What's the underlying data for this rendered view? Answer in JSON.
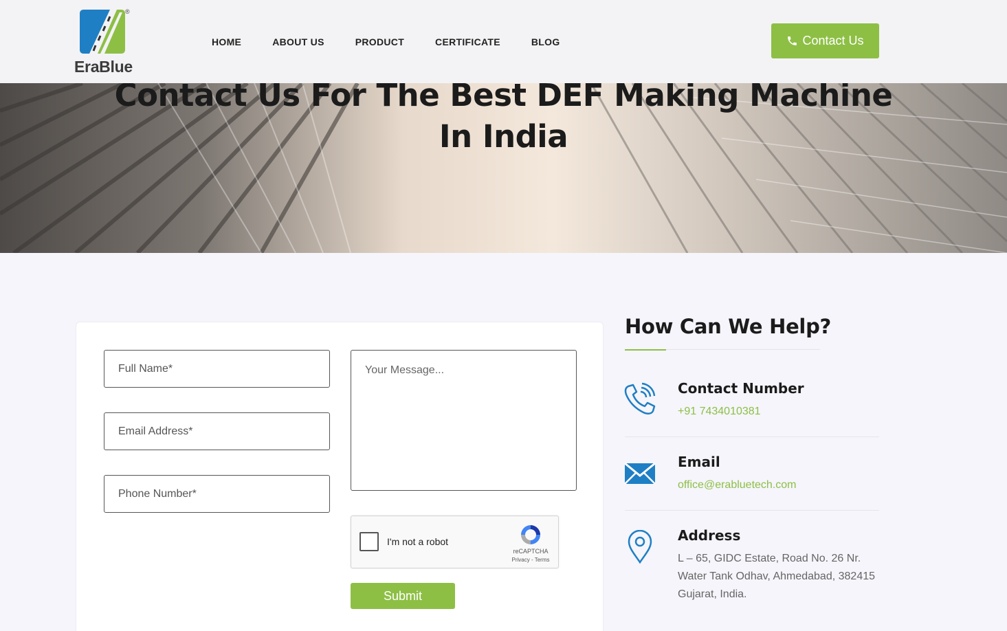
{
  "brand": {
    "name": "EraBlue",
    "registered_mark": "®"
  },
  "nav": {
    "items": [
      {
        "label": "HOME"
      },
      {
        "label": "ABOUT US"
      },
      {
        "label": "PRODUCT"
      },
      {
        "label": "CERTIFICATE"
      },
      {
        "label": "BLOG"
      }
    ]
  },
  "header_cta": {
    "label": "Contact Us",
    "icon": "phone-icon"
  },
  "hero": {
    "title_line1": "Contact Us For The Best DEF Making Machine",
    "title_line2": "In India"
  },
  "form": {
    "full_name_placeholder": "Full Name*",
    "email_placeholder": "Email Address*",
    "phone_placeholder": "Phone Number*",
    "message_placeholder": "Your Message...",
    "captcha": {
      "label": "I'm not a robot",
      "brand": "reCAPTCHA",
      "links": "Privacy - Terms"
    },
    "submit_label": "Submit"
  },
  "help": {
    "title": "How Can We Help?",
    "contact": {
      "title": "Contact Number",
      "value": "+91 7434010381",
      "icon": "phone-ringing-icon"
    },
    "email": {
      "title": "Email",
      "value": "office@erabluetech.com",
      "icon": "envelope-icon"
    },
    "address": {
      "title": "Address",
      "line1": "L – 65, GIDC Estate, Road No. 26 Nr.",
      "line2": "Water Tank Odhav, Ahmedabad, 382415",
      "line3": "Gujarat, India.",
      "icon": "location-pin-icon"
    }
  },
  "colors": {
    "accent": "#8dbf45",
    "icon_blue": "#1f7fc4",
    "heading": "#1b1b1b"
  }
}
